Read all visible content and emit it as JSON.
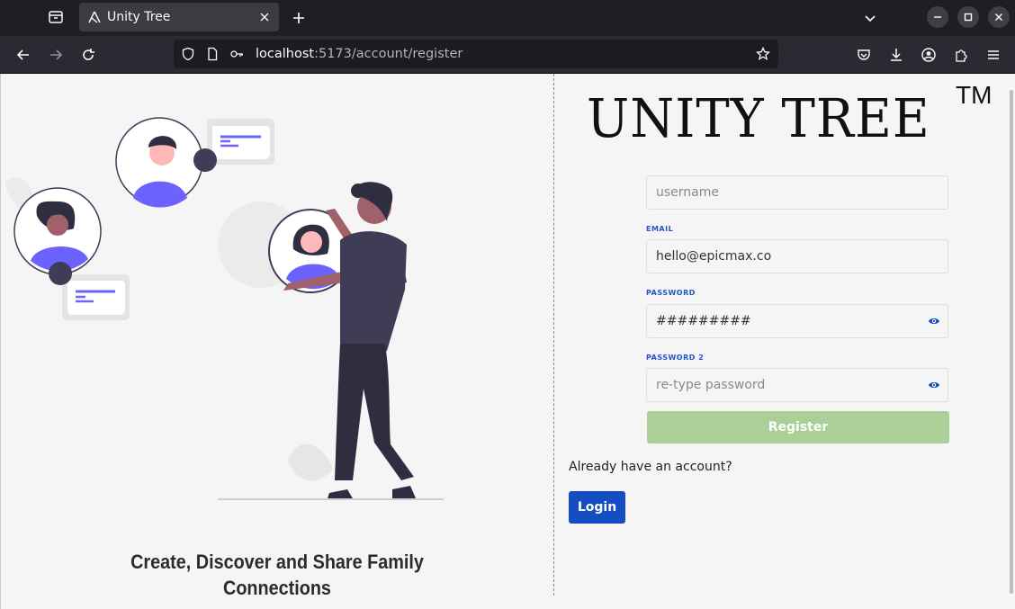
{
  "browser": {
    "tab_title": "Unity Tree",
    "url_host": "localhost",
    "url_rest": ":5173/account/register"
  },
  "page": {
    "tagline": "Create, Discover and Share Family Connections",
    "logo_text": "UNITY TREE",
    "logo_tm": "TM",
    "form": {
      "username_placeholder": "username",
      "email_label": "EMAIL",
      "email_value": "hello@epicmax.co",
      "password_label": "PASSWORD",
      "password_value": "#########",
      "password2_label": "PASSWORD 2",
      "password2_placeholder": "re-type password",
      "register_label": "Register"
    },
    "already_text": "Already have an account?",
    "login_label": "Login",
    "colors": {
      "accent_blue": "#154ec1",
      "register_green": "#aacf97",
      "illustration_purple": "#6c63ff",
      "figure_dark": "#3f3d56"
    }
  }
}
